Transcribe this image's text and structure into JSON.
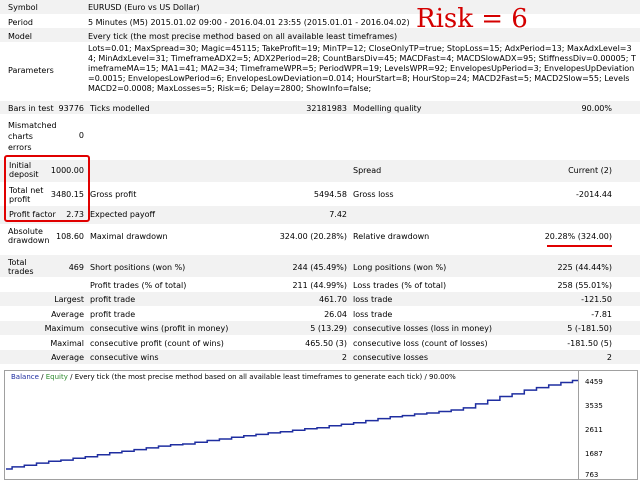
{
  "title_overlay": "Risk = 6",
  "header": {
    "symbol_label": "Symbol",
    "symbol_value": "EURUSD (Euro vs US Dollar)",
    "period_label": "Period",
    "period_value": "5 Minutes (M5) 2015.01.02 09:00 - 2016.04.01 23:55 (2015.01.01 - 2016.04.02)",
    "model_label": "Model",
    "model_value": "Every tick (the most precise method based on all available least timeframes)",
    "parameters_label": "Parameters",
    "parameters_value": "Lots=0.01; MaxSpread=30; Magic=45115; TakeProfit=19; MinTP=12; CloseOnlyTP=true; StopLoss=15; AdxPeriod=13; MaxAdxLevel=34; MinAdxLevel=31; TimeframeADX2=5; ADX2Period=28; CountBarsDiv=45; MACDFast=4; MACDSlowADX=95; StiffnessDiv=0.00005; TimeframeMA=15; MA1=41; MA2=34; TimeframeWPR=5; PeriodWPR=19; LevelsWPR=92; EnvelopesUpPeriod=3; EnvelopesUpDeviation=0.0015; EnvelopesLowPeriod=6; EnvelopesLowDeviation=0.014; HourStart=8; HourStop=24; MACD2Fast=5; MACD2Slow=55; LevelsMACD2=0.0008; MaxLosses=5; Risk=6; Delay=2800; ShowInfo=false;"
  },
  "bars": {
    "bars_label": "Bars in test",
    "bars_value": "93776",
    "ticks_label": "Ticks modelled",
    "ticks_value": "32181983",
    "quality_label": "Modelling quality",
    "quality_value": "90.00%"
  },
  "mismatched": {
    "label": "Mismatched charts errors",
    "value": "0"
  },
  "deposit": {
    "label": "Initial deposit",
    "value": "1000.00",
    "spread_label": "Spread",
    "spread_value": "Current (2)"
  },
  "profit": {
    "net_label": "Total net profit",
    "net_value": "3480.15",
    "gross_profit_label": "Gross profit",
    "gross_profit_value": "5494.58",
    "gross_loss_label": "Gross loss",
    "gross_loss_value": "-2014.44"
  },
  "factor": {
    "label": "Profit factor",
    "value": "2.73",
    "payoff_label": "Expected payoff",
    "payoff_value": "7.42"
  },
  "drawdown": {
    "abs_label": "Absolute drawdown",
    "abs_value": "108.60",
    "max_label": "Maximal drawdown",
    "max_value": "324.00 (20.28%)",
    "rel_label": "Relative drawdown",
    "rel_value": "20.28% (324.00)"
  },
  "trades": {
    "total_label": "Total trades",
    "total_value": "469",
    "short_label": "Short positions (won %)",
    "short_value": "244 (45.49%)",
    "long_label": "Long positions (won %)",
    "long_value": "225 (44.44%)",
    "pt_label": "Profit trades (% of total)",
    "pt_value": "211 (44.99%)",
    "lt_label": "Loss trades (% of total)",
    "lt_value": "258 (55.01%)"
  },
  "largest": {
    "label": "Largest",
    "profit_label": "profit trade",
    "profit_value": "461.70",
    "loss_label": "loss trade",
    "loss_value": "-121.50"
  },
  "average": {
    "label": "Average",
    "profit_label": "profit trade",
    "profit_value": "26.04",
    "loss_label": "loss trade",
    "loss_value": "-7.81"
  },
  "maximum": {
    "label": "Maximum",
    "wins_label": "consecutive wins (profit in money)",
    "wins_value": "5 (13.29)",
    "losses_label": "consecutive losses (loss in money)",
    "losses_value": "5 (-181.50)"
  },
  "maximal": {
    "label": "Maximal",
    "profit_label": "consecutive profit (count of wins)",
    "profit_value": "465.50 (3)",
    "loss_label": "consecutive loss (count of losses)",
    "loss_value": "-181.50 (5)"
  },
  "avgcons": {
    "label": "Average",
    "wins_label": "consecutive wins",
    "wins_value": "2",
    "losses_label": "consecutive losses",
    "losses_value": "2"
  },
  "chart_legend": {
    "balance": "Balance",
    "sep1": " / ",
    "equity": "Equity",
    "sep2": " / ",
    "desc": "Every tick (the most precise method based on all available least timeframes to generate each tick)",
    "sep3": " / ",
    "quality": "90.00%"
  },
  "colors": {
    "balance": "#1f2ea0",
    "equity": "#2e8b2e",
    "accent": "#d40000"
  },
  "chart_data": {
    "type": "line",
    "title": "",
    "xlabel": "",
    "ylabel": "",
    "y_ticks": [
      "4459",
      "3535",
      "2611",
      "1687",
      "763"
    ],
    "ylim": [
      763,
      4459
    ],
    "grid": false,
    "series": [
      {
        "name": "Balance",
        "x": [
          0,
          10,
          20,
          30,
          40,
          50,
          60,
          70,
          80,
          90,
          100,
          110,
          120,
          130,
          140,
          150,
          160,
          170,
          180,
          190,
          200,
          210,
          220,
          230,
          240,
          250,
          260,
          270,
          280,
          290,
          300,
          310,
          320,
          330,
          340,
          350,
          360,
          370,
          380,
          390,
          400,
          410,
          420,
          430,
          440,
          450,
          460,
          469
        ],
        "values": [
          1000,
          1080,
          1150,
          1230,
          1300,
          1350,
          1420,
          1480,
          1560,
          1640,
          1700,
          1760,
          1830,
          1900,
          1950,
          1980,
          2050,
          2120,
          2180,
          2250,
          2310,
          2360,
          2420,
          2460,
          2520,
          2580,
          2620,
          2700,
          2760,
          2820,
          2900,
          2980,
          3050,
          3100,
          3160,
          3200,
          3260,
          3320,
          3400,
          3560,
          3700,
          3850,
          3950,
          4100,
          4200,
          4300,
          4400,
          4480
        ]
      }
    ]
  }
}
